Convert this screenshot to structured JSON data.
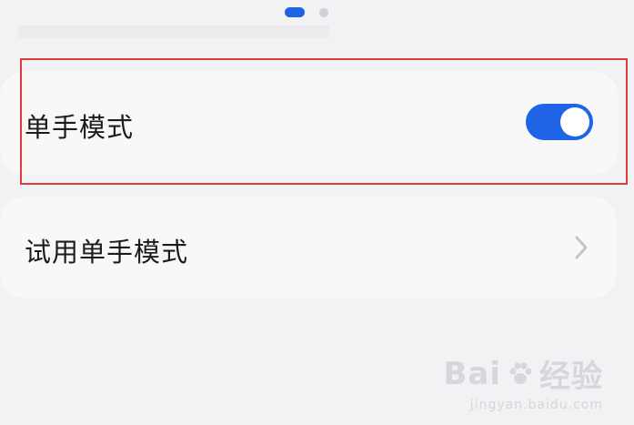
{
  "settings": {
    "one_hand_mode": {
      "label": "单手模式",
      "enabled": true,
      "toggle_color": "#1f63e6"
    },
    "try_one_hand_mode": {
      "label": "试用单手模式"
    }
  },
  "page_indicator": {
    "active_page": 1,
    "total_pages": 2
  },
  "highlight_color": "#e5383b",
  "watermark": {
    "brand_prefix": "Bai",
    "brand_suffix": "经验",
    "url": "jingyan.baidu.com"
  }
}
